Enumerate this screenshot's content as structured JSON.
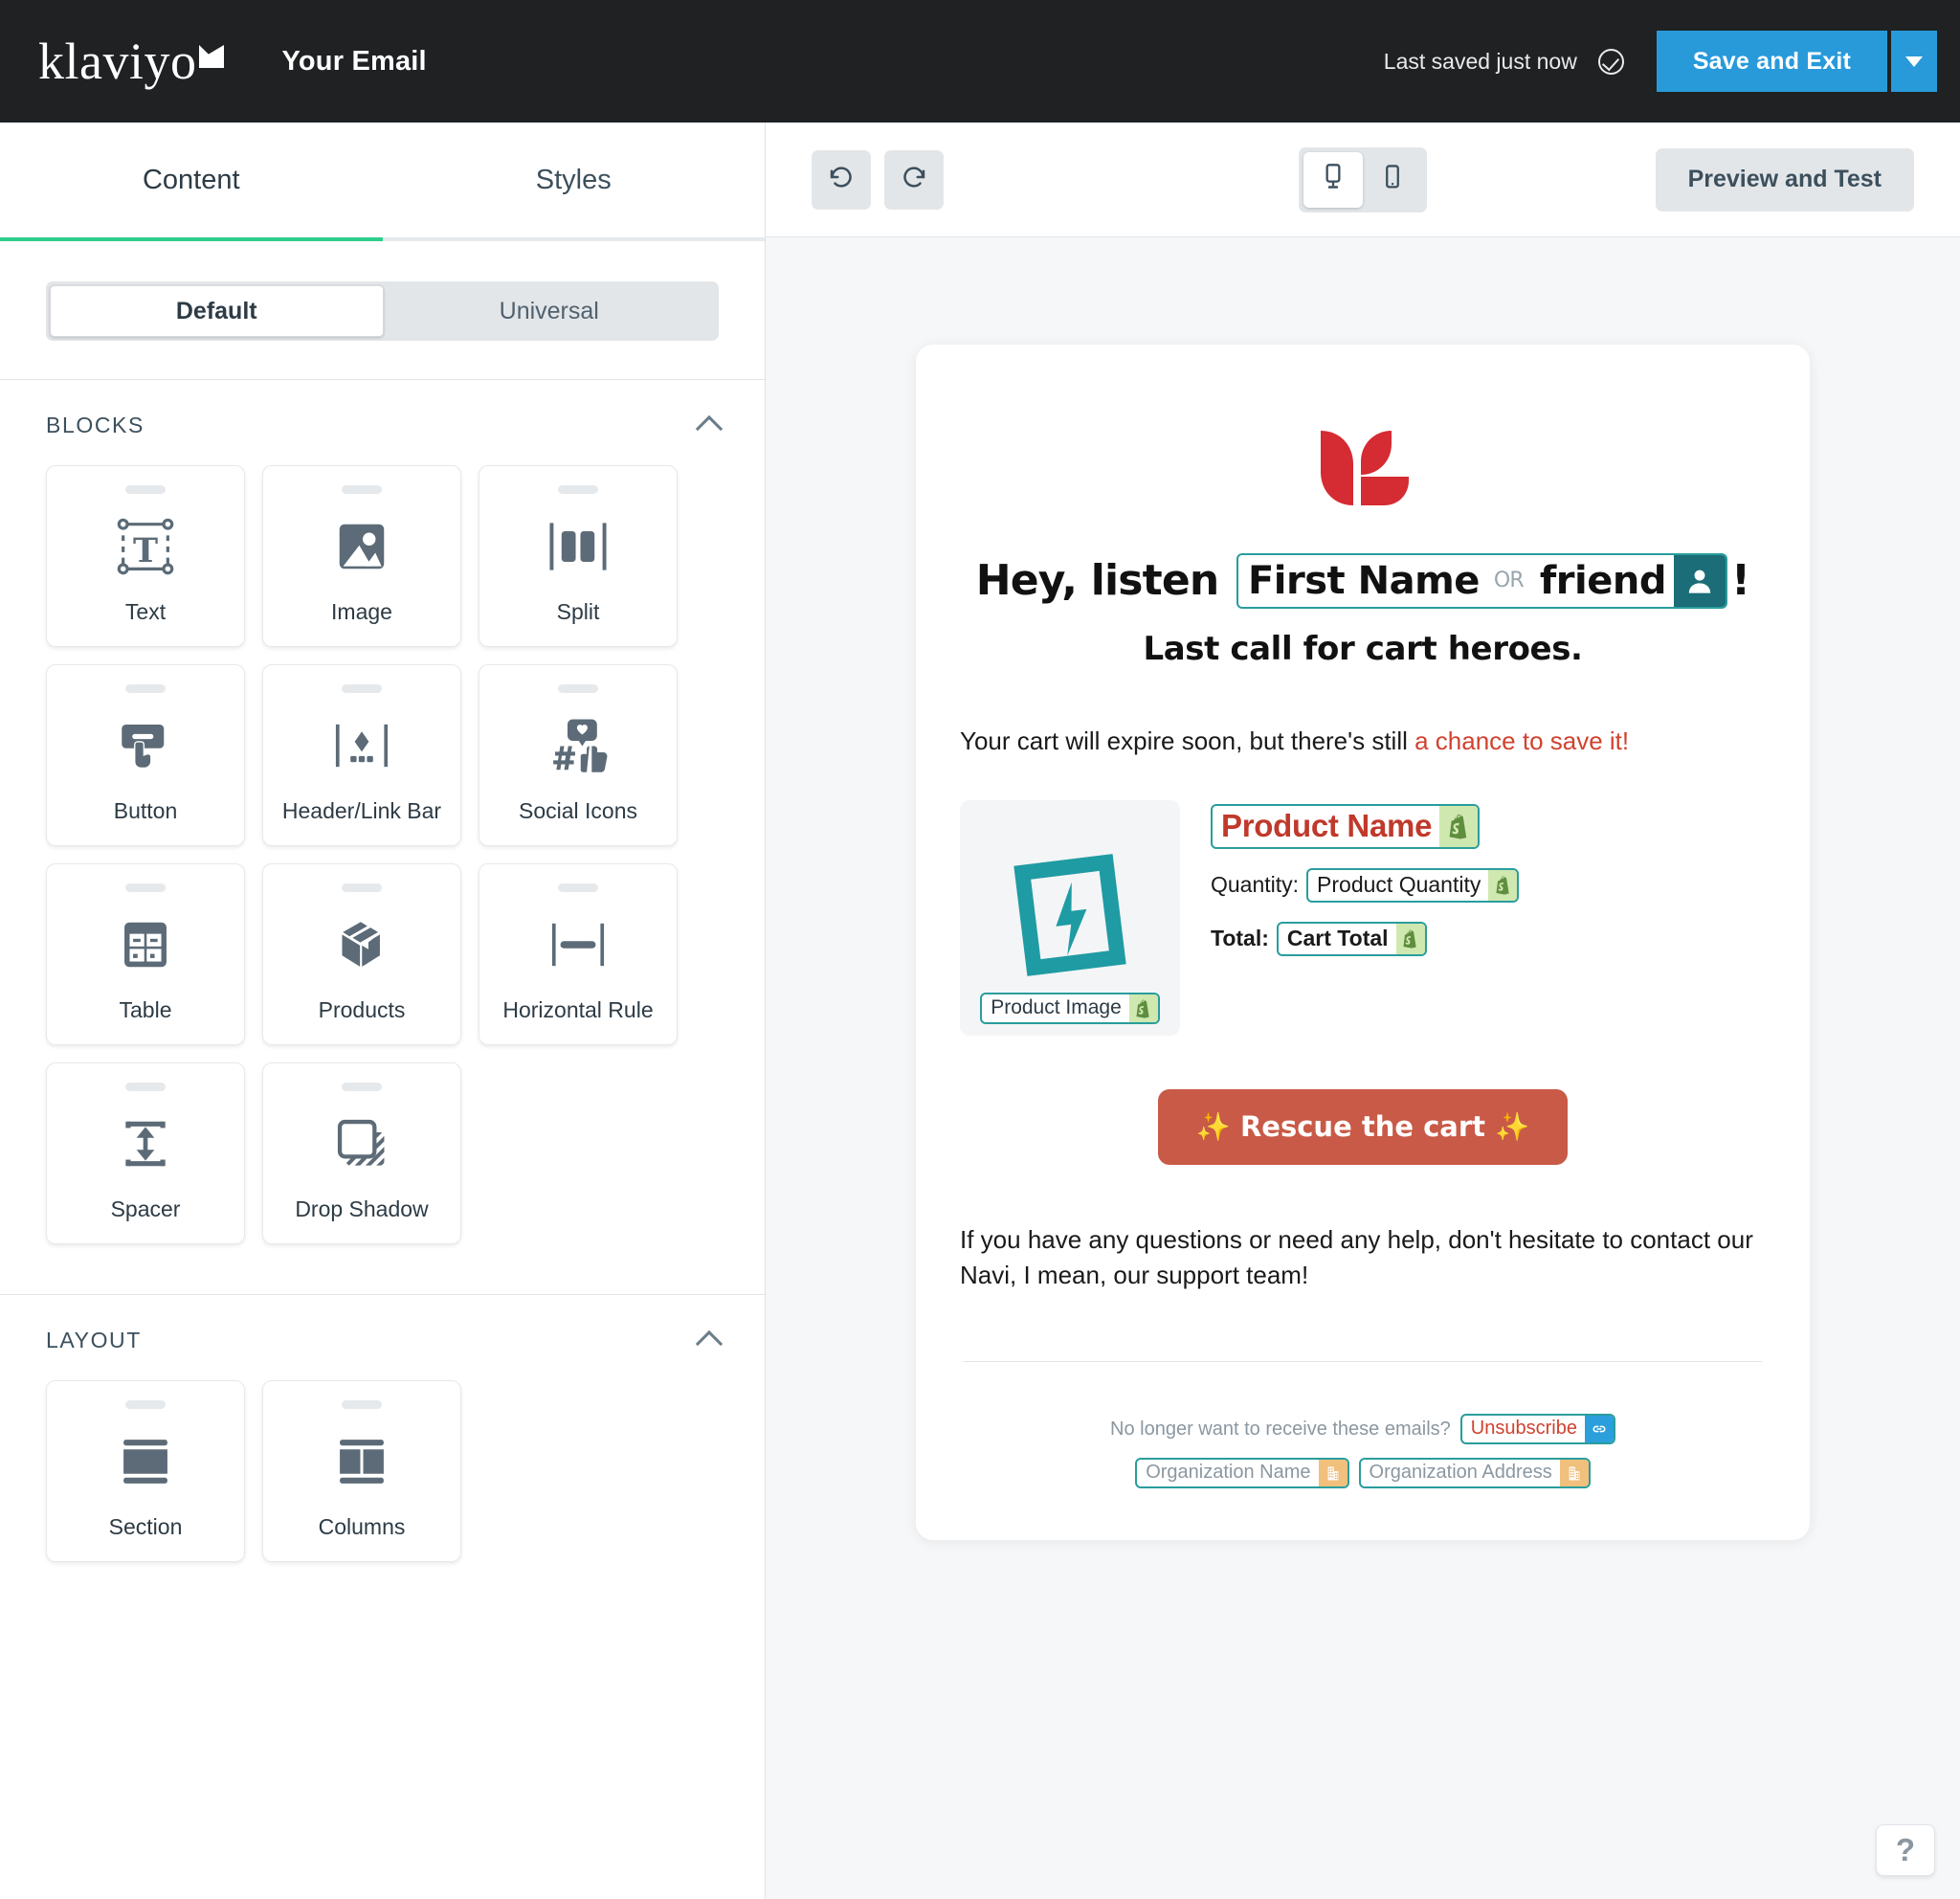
{
  "topbar": {
    "brand": "klaviyo",
    "document_title": "Your Email",
    "saved_status": "Last saved just now",
    "save_button": "Save and Exit",
    "save_caret_icon": "chevron-down-icon",
    "saved_icon": "check-circle-icon",
    "accent_blue": "#289ada",
    "background": "#1f2123"
  },
  "left_panel": {
    "tabs": [
      {
        "label": "Content",
        "active": true
      },
      {
        "label": "Styles",
        "active": false
      }
    ],
    "active_underline_color": "#2dce89",
    "mode_toggle": {
      "options": [
        {
          "label": "Default",
          "selected": true
        },
        {
          "label": "Universal",
          "selected": false
        }
      ]
    },
    "sections": [
      {
        "title": "BLOCKS",
        "collapse_icon": "chevron-up-icon",
        "items": [
          {
            "label": "Text",
            "icon": "text-block-icon"
          },
          {
            "label": "Image",
            "icon": "image-block-icon"
          },
          {
            "label": "Split",
            "icon": "split-block-icon"
          },
          {
            "label": "Button",
            "icon": "button-block-icon"
          },
          {
            "label": "Header/Link Bar",
            "icon": "header-link-bar-icon"
          },
          {
            "label": "Social Icons",
            "icon": "social-icons-block-icon"
          },
          {
            "label": "Table",
            "icon": "table-block-icon"
          },
          {
            "label": "Products",
            "icon": "products-block-icon"
          },
          {
            "label": "Horizontal Rule",
            "icon": "horizontal-rule-icon"
          },
          {
            "label": "Spacer",
            "icon": "spacer-block-icon"
          },
          {
            "label": "Drop Shadow",
            "icon": "drop-shadow-icon"
          }
        ]
      },
      {
        "title": "LAYOUT",
        "collapse_icon": "chevron-up-icon",
        "items": [
          {
            "label": "Section",
            "icon": "section-layout-icon"
          },
          {
            "label": "Columns",
            "icon": "columns-layout-icon"
          }
        ]
      }
    ]
  },
  "canvas_toolbar": {
    "undo_icon": "undo-icon",
    "redo_icon": "redo-icon",
    "devices": [
      {
        "name": "desktop",
        "icon": "desktop-icon",
        "selected": true
      },
      {
        "name": "mobile",
        "icon": "mobile-icon",
        "selected": false
      }
    ],
    "preview_button": "Preview and Test"
  },
  "email": {
    "logo_icon": "klaviyo-leaf-logo",
    "logo_color": "#d52b33",
    "headline": {
      "prefix": "Hey, listen ",
      "token_primary": "First Name",
      "token_or": "OR",
      "token_fallback": "friend",
      "token_badge_icon": "person-icon",
      "suffix": "!"
    },
    "subheadline": "Last call for cart heroes.",
    "body": {
      "text_plain": "Your cart will expire soon, but there's still ",
      "text_accent": "a chance to save it!",
      "accent_color": "#d0422f"
    },
    "product": {
      "image_placeholder_icon": "image-placeholder-icon",
      "image_tag": "Product Image",
      "image_tag_badge": "shopify-icon",
      "name_tag": "Product Name",
      "name_tag_badge": "shopify-icon",
      "quantity_label": "Quantity:",
      "quantity_tag": "Product Quantity",
      "quantity_tag_badge": "shopify-icon",
      "total_label": "Total:",
      "total_tag": "Cart Total",
      "total_tag_badge": "shopify-icon"
    },
    "cta": {
      "label": "Rescue the cart",
      "spark_left": "✨",
      "spark_right": "✨",
      "background": "#c85a47"
    },
    "support_text": "If you have any questions or need any help, don't hesitate to contact our Navi, I mean, our support team!",
    "footer": {
      "unsub_prompt": "No longer want to receive these emails?",
      "unsubscribe_tag": "Unsubscribe",
      "unsubscribe_badge": "link-icon",
      "org_name_tag": "Organization Name",
      "org_name_badge": "building-icon",
      "org_address_tag": "Organization Address",
      "org_address_badge": "building-icon"
    }
  },
  "help": {
    "label": "?"
  }
}
